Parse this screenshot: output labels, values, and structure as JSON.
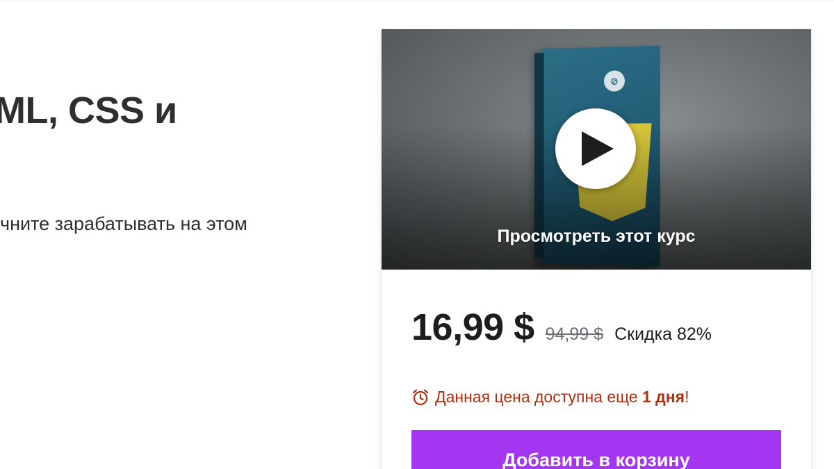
{
  "course": {
    "title": "ML, CSS и",
    "subtitle": "чните зарабатывать на этом"
  },
  "preview": {
    "label": "Просмотреть этот курс",
    "play_icon": "play-icon"
  },
  "pricing": {
    "current_price": "16,99 $",
    "original_price": "94,99 $",
    "discount_label": "Скидка 82%",
    "timer_icon": "alarm-clock-icon",
    "timer_prefix": "Данная цена доступна еще ",
    "timer_duration": "1 дня",
    "timer_suffix": "!"
  },
  "cart": {
    "add_label": "Добавить в корзину"
  },
  "colors": {
    "accent": "#a435f0",
    "timer": "#b32d0f",
    "text": "#1c1d1f",
    "muted": "#6a6f73"
  }
}
